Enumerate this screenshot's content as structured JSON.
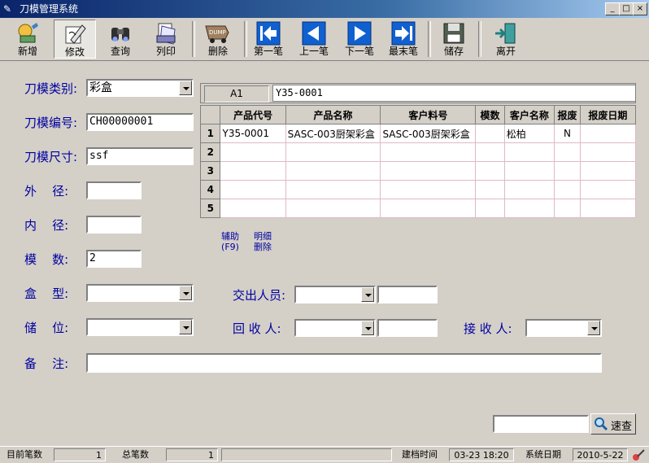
{
  "window": {
    "title": "刀模管理系统",
    "min": "_",
    "max": "□",
    "close": "×"
  },
  "toolbar": {
    "add": "新增",
    "edit": "修改",
    "query": "查询",
    "print": "列印",
    "delete": "删除",
    "first": "第一笔",
    "prev": "上一笔",
    "next": "下一笔",
    "last": "最末笔",
    "save": "储存",
    "exit": "离开"
  },
  "form": {
    "type_label": "刀模类别:",
    "type_value": "彩盒",
    "code_label": "刀模编号:",
    "code_value": "CH00000001",
    "size_label": "刀模尺寸:",
    "size_value": "ssf",
    "outer_label": "外    径:",
    "outer_value": "",
    "inner_label": "内    径:",
    "inner_value": "",
    "count_label": "模    数:",
    "count_value": "2",
    "box_label": "盒    型:",
    "box_value": "",
    "storage_label": "储    位:",
    "storage_value": "",
    "note_label": "备    注:",
    "note_value": "",
    "handover_label": "交出人员:",
    "handover_value": "",
    "handover_extra": "",
    "recycle_label": "回 收 人:",
    "recycle_value": "",
    "recycle_extra": "",
    "receiver_label": "接 收 人:",
    "receiver_value": ""
  },
  "grid": {
    "cell_ref": "A1",
    "cell_value": "Y35-0001",
    "headers": [
      "产品代号",
      "产品名称",
      "客户料号",
      "模数",
      "客户名称",
      "报废",
      "报废日期"
    ],
    "rows": [
      {
        "n": "1",
        "cells": [
          "Y35-0001",
          "SASC-003厨架彩盒",
          "SASC-003厨架彩盒",
          "",
          "松柏",
          "N",
          ""
        ]
      },
      {
        "n": "2",
        "cells": [
          "",
          "",
          "",
          "",
          "",
          "",
          ""
        ]
      },
      {
        "n": "3",
        "cells": [
          "",
          "",
          "",
          "",
          "",
          "",
          ""
        ]
      },
      {
        "n": "4",
        "cells": [
          "",
          "",
          "",
          "",
          "",
          "",
          ""
        ]
      },
      {
        "n": "5",
        "cells": [
          "",
          "",
          "",
          "",
          "",
          "",
          ""
        ]
      }
    ]
  },
  "links": {
    "assist": "辅助",
    "assist_key": "(F9)",
    "detail": "明细",
    "detail_del": "删除"
  },
  "search": {
    "value": "",
    "button": "速查"
  },
  "status": {
    "current_label": "目前笔数",
    "current_value": "1",
    "total_label": "总笔数",
    "total_value": "1",
    "created_label": "建档时间",
    "created_value": "03-23 18:20",
    "sysdate_label": "系统日期",
    "sysdate_value": "2010-5-22"
  }
}
